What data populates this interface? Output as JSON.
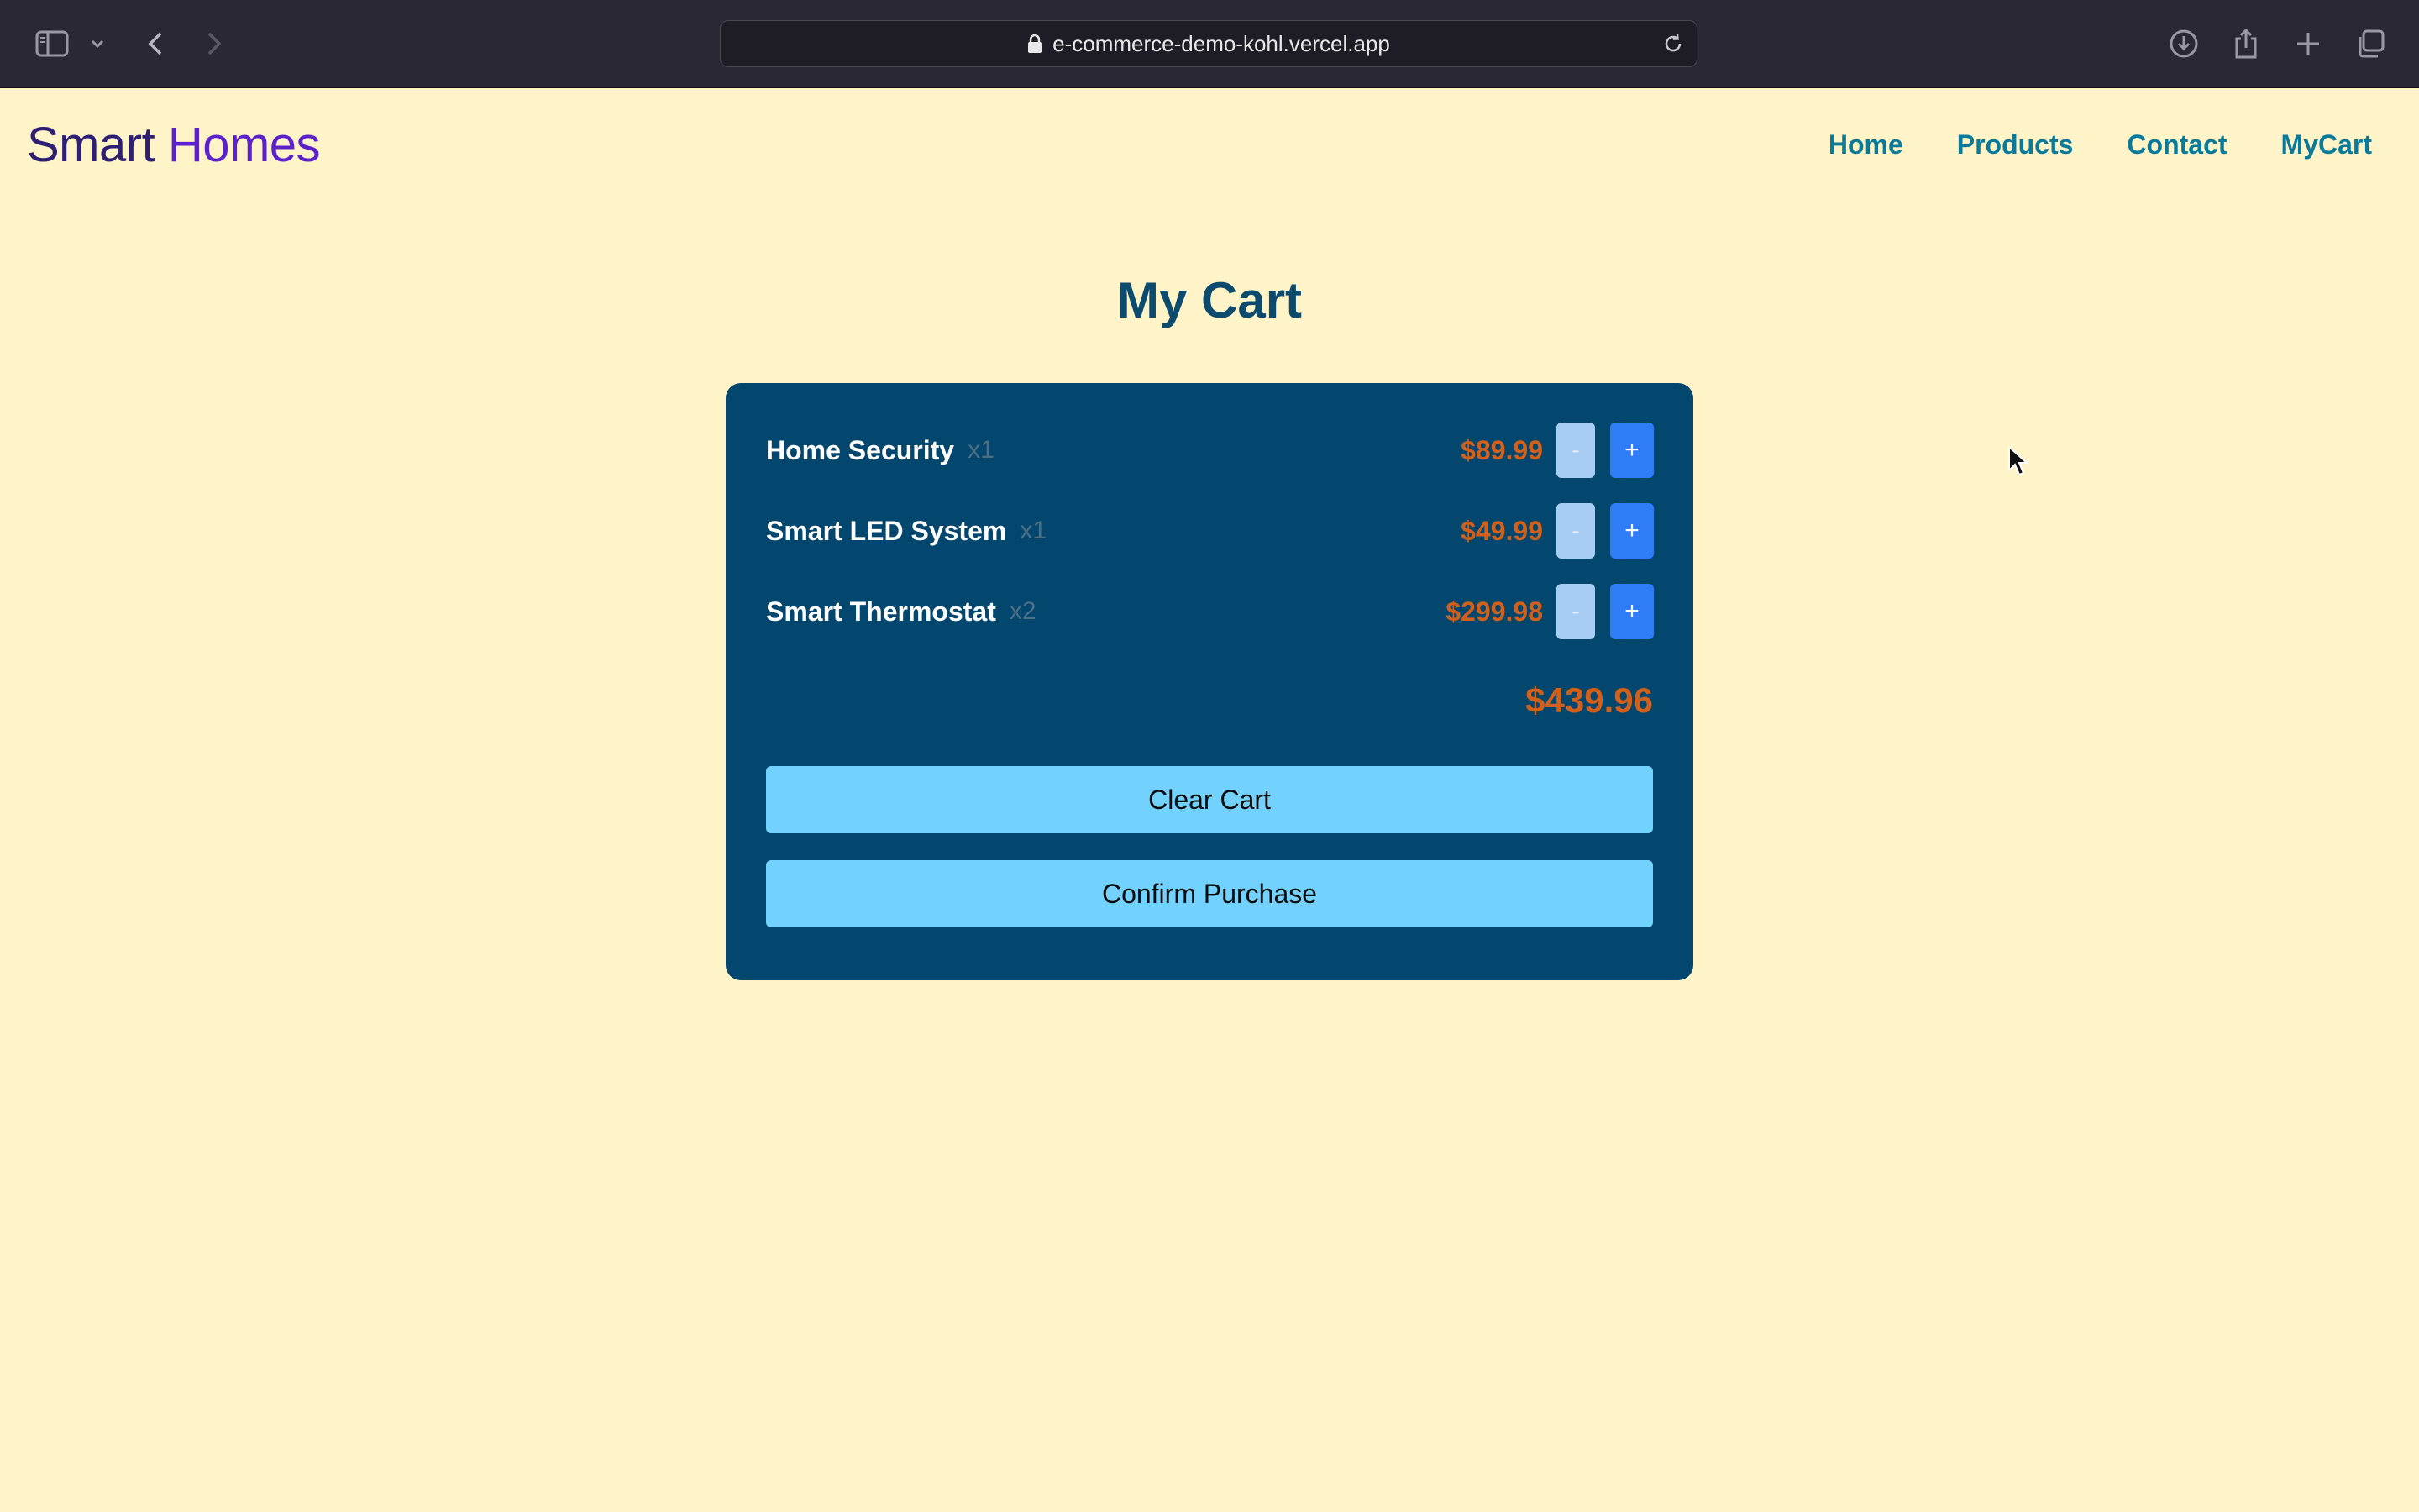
{
  "browser": {
    "url": "e-commerce-demo-kohl.vercel.app"
  },
  "site": {
    "title_word1": "Smart",
    "title_word2": "Homes"
  },
  "nav": {
    "items": [
      {
        "label": "Home"
      },
      {
        "label": "Products"
      },
      {
        "label": "Contact"
      },
      {
        "label": "MyCart"
      }
    ]
  },
  "page": {
    "title": "My Cart"
  },
  "cart": {
    "items": [
      {
        "name": "Home Security",
        "qty": "x1",
        "price": "$89.99"
      },
      {
        "name": "Smart LED System",
        "qty": "x1",
        "price": "$49.99"
      },
      {
        "name": "Smart Thermostat",
        "qty": "x2",
        "price": "$299.98"
      }
    ],
    "minus_label": "-",
    "plus_label": "+",
    "total": "$439.96",
    "clear_label": "Clear Cart",
    "confirm_label": "Confirm Purchase"
  },
  "colors": {
    "background": "#fff3c8",
    "card": "#03476e",
    "price": "#d2601a",
    "nav_link": "#0a7a9a",
    "action_button": "#73d2fd",
    "plus_button": "#2f7df6",
    "minus_button": "#a8cdf5"
  }
}
